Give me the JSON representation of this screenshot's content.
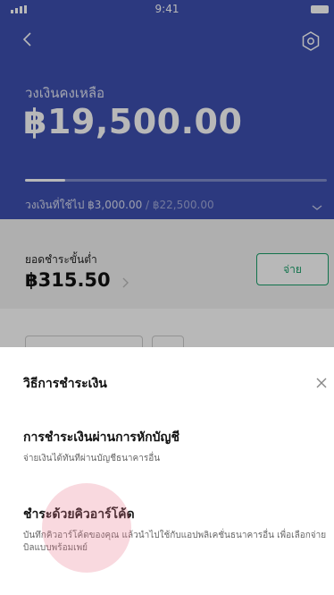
{
  "status_bar": {
    "time": "9:41"
  },
  "header": {
    "balance_label": "วงเงินคงเหลือ",
    "balance_amount": "฿19,500.00",
    "credit_used_label": "วงเงินที่ใช้ไป ฿3,000.00",
    "credit_limit": " / ฿22,500.00",
    "usage_fraction": 0.133
  },
  "minimum_payment": {
    "label": "ยอดชำระขั้นต่ำ",
    "amount": "฿315.50",
    "pay_button_label": "จ่าย"
  },
  "payment_sheet": {
    "title": "วิธีการชำระเงิน",
    "options": [
      {
        "title": "การชำระเงินผ่านการหักบัญชี",
        "subtitle": "จ่ายเงินได้ทันทีผ่านบัญชีธนาคารอื่น"
      },
      {
        "title": "ชำระด้วยคิวอาร์โค้ด",
        "subtitle": "บันทึกคิวอาร์โค้ดของคุณ แล้วนำไปใช้กับแอปพลิเคชั่นธนาคารอื่น เพื่อเลือกจ่ายบิลแบบพร้อมเพย์"
      }
    ]
  },
  "colors": {
    "header_bg": "#3d4fb1",
    "accent_green": "#18a06a"
  },
  "icons": [
    "back-arrow-icon",
    "settings-icon",
    "chevron-down-icon",
    "chevron-right-icon",
    "close-icon"
  ]
}
